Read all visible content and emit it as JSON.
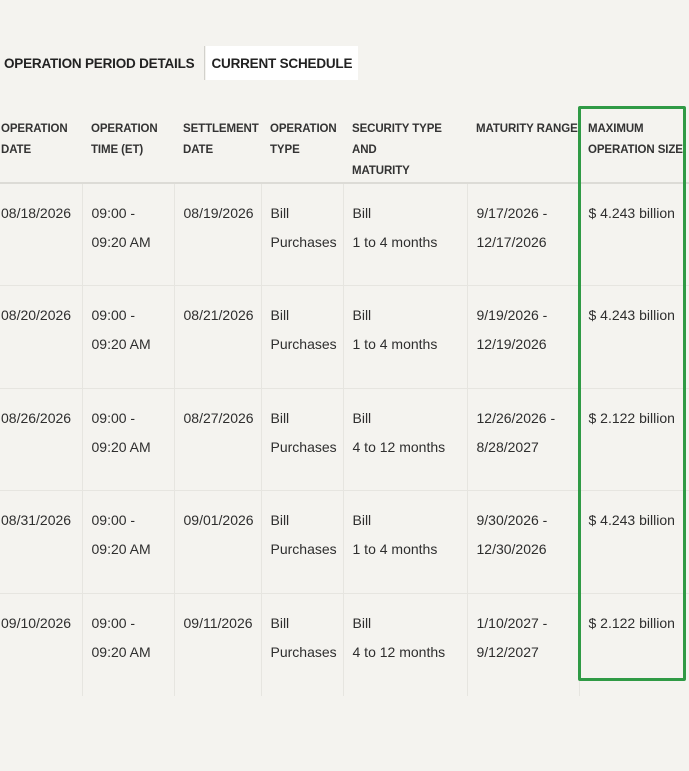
{
  "tabs": {
    "operation_period_details": "OPERATION PERIOD DETAILS",
    "current_schedule": "CURRENT SCHEDULE"
  },
  "table": {
    "headers": {
      "operation_date": [
        "OPERATION",
        "DATE"
      ],
      "operation_time": [
        "OPERATION",
        "TIME (ET)"
      ],
      "settlement_date": [
        "SETTLEMENT",
        "DATE"
      ],
      "operation_type": [
        "OPERATION",
        "TYPE"
      ],
      "security_type": [
        "SECURITY TYPE AND",
        "MATURITY"
      ],
      "maturity_range": [
        "MATURITY RANGE"
      ],
      "max_size": [
        "MAXIMUM",
        "OPERATION SIZE"
      ]
    },
    "rows": [
      {
        "operation_date": "08/18/2026",
        "time": [
          "09:00 -",
          "09:20 AM"
        ],
        "settlement_date": "08/19/2026",
        "operation_type": [
          "Bill",
          "Purchases"
        ],
        "security": [
          "Bill",
          "1 to 4 months"
        ],
        "maturity_range": [
          "9/17/2026 -",
          "12/17/2026"
        ],
        "max_size": "$ 4.243 billion"
      },
      {
        "operation_date": "08/20/2026",
        "time": [
          "09:00 -",
          "09:20 AM"
        ],
        "settlement_date": "08/21/2026",
        "operation_type": [
          "Bill",
          "Purchases"
        ],
        "security": [
          "Bill",
          "1 to 4 months"
        ],
        "maturity_range": [
          "9/19/2026 -",
          "12/19/2026"
        ],
        "max_size": "$ 4.243 billion"
      },
      {
        "operation_date": "08/26/2026",
        "time": [
          "09:00 -",
          "09:20 AM"
        ],
        "settlement_date": "08/27/2026",
        "operation_type": [
          "Bill",
          "Purchases"
        ],
        "security": [
          "Bill",
          "4 to 12 months"
        ],
        "maturity_range": [
          "12/26/2026 -",
          "8/28/2027"
        ],
        "max_size": "$ 2.122 billion"
      },
      {
        "operation_date": "08/31/2026",
        "time": [
          "09:00 -",
          "09:20 AM"
        ],
        "settlement_date": "09/01/2026",
        "operation_type": [
          "Bill",
          "Purchases"
        ],
        "security": [
          "Bill",
          "1 to 4 months"
        ],
        "maturity_range": [
          "9/30/2026 -",
          "12/30/2026"
        ],
        "max_size": "$ 4.243 billion"
      },
      {
        "operation_date": "09/10/2026",
        "time": [
          "09:00 -",
          "09:20 AM"
        ],
        "settlement_date": "09/11/2026",
        "operation_type": [
          "Bill",
          "Purchases"
        ],
        "security": [
          "Bill",
          "4 to 12 months"
        ],
        "maturity_range": [
          "1/10/2027 -",
          "9/12/2027"
        ],
        "max_size": "$ 2.122 billion"
      }
    ]
  },
  "colors": {
    "background": "#f4f3ef",
    "active_tab": "#ffffff",
    "highlight": "#2f9a45"
  }
}
